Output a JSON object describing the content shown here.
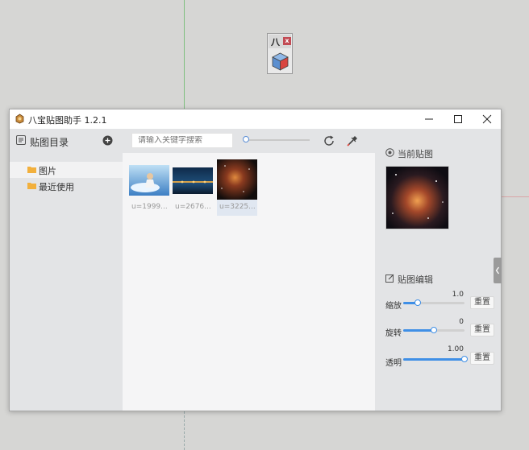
{
  "toolbar": {
    "glyph": "八",
    "close_glyph": "x"
  },
  "window": {
    "title": "八宝贴图助手 1.2.1"
  },
  "sidebar": {
    "header": "贴图目录",
    "items": [
      {
        "label": "图片",
        "selected": true
      },
      {
        "label": "最近使用",
        "selected": false
      }
    ]
  },
  "search": {
    "placeholder": "请输入关键字搜索",
    "value": ""
  },
  "gallery": {
    "items": [
      {
        "caption": "u=1999...",
        "selected": false
      },
      {
        "caption": "u=2676...",
        "selected": false
      },
      {
        "caption": "u=3225...",
        "selected": true
      }
    ]
  },
  "right_panel": {
    "current_title": "当前贴图",
    "edit_title": "贴图编辑",
    "controls": [
      {
        "label": "缩放",
        "value": "1.0",
        "fraction": 0.24,
        "reset": "重置"
      },
      {
        "label": "旋转",
        "value": "0",
        "fraction": 0.5,
        "reset": "重置"
      },
      {
        "label": "透明",
        "value": "1.00",
        "fraction": 1.0,
        "reset": "重置"
      }
    ]
  },
  "colors": {
    "accent": "#3f8fe6",
    "panel_bg": "#e3e4e6",
    "gallery_bg": "#f5f5f6"
  }
}
